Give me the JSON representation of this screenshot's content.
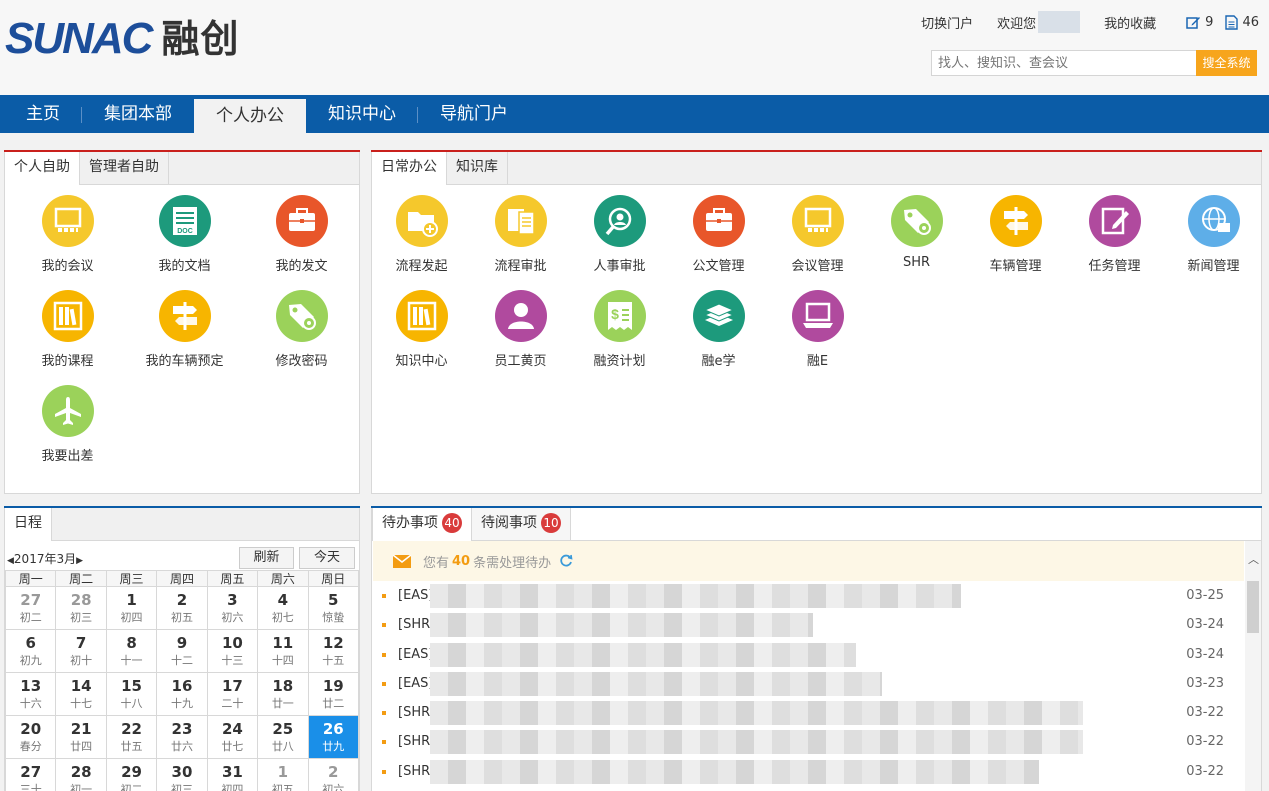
{
  "header": {
    "logo_en": "SUNAC",
    "logo_cn": "融创",
    "switch_portal": "切换门户",
    "welcome": "欢迎您",
    "favorites": "我的收藏",
    "edit_count": "9",
    "doc_count": "46",
    "search_placeholder": "找人、搜知识、查会议",
    "search_button": "搜全系统"
  },
  "nav": {
    "items": [
      "主页",
      "集团本部",
      "个人办公",
      "知识中心",
      "导航门户"
    ],
    "active": "个人办公"
  },
  "self_service": {
    "tabs": [
      "个人自助",
      "管理者自助"
    ],
    "items": [
      {
        "label": "我的会议",
        "icon": "meeting-icon",
        "color": "#f5c82c"
      },
      {
        "label": "我的文档",
        "icon": "doc-icon",
        "color": "#1d9a7c"
      },
      {
        "label": "我的发文",
        "icon": "briefcase-icon",
        "color": "#e8562a"
      },
      {
        "label": "我的课程",
        "icon": "bookshelf-icon",
        "color": "#f7b500"
      },
      {
        "label": "我的车辆预定",
        "icon": "signpost-icon",
        "color": "#f7b500"
      },
      {
        "label": "修改密码",
        "icon": "tag-gear-icon",
        "color": "#9bd25a"
      },
      {
        "label": "我要出差",
        "icon": "airplane-icon",
        "color": "#9bd25a"
      }
    ]
  },
  "daily_office": {
    "tabs": [
      "日常办公",
      "知识库"
    ],
    "items": [
      {
        "label": "流程发起",
        "icon": "folder-plus-icon",
        "color": "#f5c82c"
      },
      {
        "label": "流程审批",
        "icon": "approval-icon",
        "color": "#f5c82c"
      },
      {
        "label": "人事审批",
        "icon": "person-search-icon",
        "color": "#1d9a7c"
      },
      {
        "label": "公文管理",
        "icon": "briefcase-icon",
        "color": "#e8562a"
      },
      {
        "label": "会议管理",
        "icon": "meeting-icon",
        "color": "#f5c82c"
      },
      {
        "label": "SHR",
        "icon": "tag-gear-icon",
        "color": "#9bd25a"
      },
      {
        "label": "车辆管理",
        "icon": "signpost-icon",
        "color": "#f7b500"
      },
      {
        "label": "任务管理",
        "icon": "task-edit-icon",
        "color": "#b04a9e"
      },
      {
        "label": "新闻管理",
        "icon": "globe-icon",
        "color": "#5eaee8"
      },
      {
        "label": "知识中心",
        "icon": "bookshelf-icon",
        "color": "#f7b500"
      },
      {
        "label": "员工黄页",
        "icon": "person-icon",
        "color": "#b04a9e"
      },
      {
        "label": "融资计划",
        "icon": "finance-icon",
        "color": "#9bd25a"
      },
      {
        "label": "融e学",
        "icon": "books-icon",
        "color": "#1d9a7c"
      },
      {
        "label": "融E",
        "icon": "laptop-icon",
        "color": "#b04a9e"
      }
    ]
  },
  "calendar": {
    "tab": "日程",
    "month": "2017年3月",
    "refresh": "刷新",
    "today": "今天",
    "weekdays": [
      "周一",
      "周二",
      "周三",
      "周四",
      "周五",
      "周六",
      "周日"
    ],
    "weeks": [
      [
        {
          "d": "27",
          "l": "初二",
          "o": true
        },
        {
          "d": "28",
          "l": "初三",
          "o": true
        },
        {
          "d": "1",
          "l": "初四"
        },
        {
          "d": "2",
          "l": "初五"
        },
        {
          "d": "3",
          "l": "初六"
        },
        {
          "d": "4",
          "l": "初七"
        },
        {
          "d": "5",
          "l": "惊蛰"
        }
      ],
      [
        {
          "d": "6",
          "l": "初九"
        },
        {
          "d": "7",
          "l": "初十"
        },
        {
          "d": "8",
          "l": "十一"
        },
        {
          "d": "9",
          "l": "十二"
        },
        {
          "d": "10",
          "l": "十三"
        },
        {
          "d": "11",
          "l": "十四"
        },
        {
          "d": "12",
          "l": "十五"
        }
      ],
      [
        {
          "d": "13",
          "l": "十六"
        },
        {
          "d": "14",
          "l": "十七"
        },
        {
          "d": "15",
          "l": "十八"
        },
        {
          "d": "16",
          "l": "十九"
        },
        {
          "d": "17",
          "l": "二十"
        },
        {
          "d": "18",
          "l": "廿一"
        },
        {
          "d": "19",
          "l": "廿二"
        }
      ],
      [
        {
          "d": "20",
          "l": "春分"
        },
        {
          "d": "21",
          "l": "廿四"
        },
        {
          "d": "22",
          "l": "廿五"
        },
        {
          "d": "23",
          "l": "廿六"
        },
        {
          "d": "24",
          "l": "廿七"
        },
        {
          "d": "25",
          "l": "廿八"
        },
        {
          "d": "26",
          "l": "廿九",
          "t": true
        }
      ],
      [
        {
          "d": "27",
          "l": "三十"
        },
        {
          "d": "28",
          "l": "初一"
        },
        {
          "d": "29",
          "l": "初二"
        },
        {
          "d": "30",
          "l": "初三"
        },
        {
          "d": "31",
          "l": "初四"
        },
        {
          "d": "1",
          "l": "初五",
          "o": true
        },
        {
          "d": "2",
          "l": "初六",
          "o": true
        }
      ]
    ]
  },
  "todo": {
    "tabs": [
      {
        "label": "待办事项",
        "count": "40"
      },
      {
        "label": "待阅事项",
        "count": "10"
      }
    ],
    "notice_prefix": "您有",
    "notice_count": "40",
    "notice_suffix": "条需处理待办",
    "rows": [
      {
        "src": "[EAS]",
        "date": "03-25",
        "w": 0.61
      },
      {
        "src": "[SHR]",
        "date": "03-24",
        "w": 0.44
      },
      {
        "src": "[EAS]",
        "date": "03-24",
        "w": 0.49
      },
      {
        "src": "[EAS]",
        "date": "03-23",
        "w": 0.52
      },
      {
        "src": "[SHR]",
        "date": "03-22",
        "w": 0.75
      },
      {
        "src": "[SHR]",
        "date": "03-22",
        "w": 0.75
      },
      {
        "src": "[SHR]",
        "date": "03-22",
        "w": 0.7
      }
    ]
  }
}
